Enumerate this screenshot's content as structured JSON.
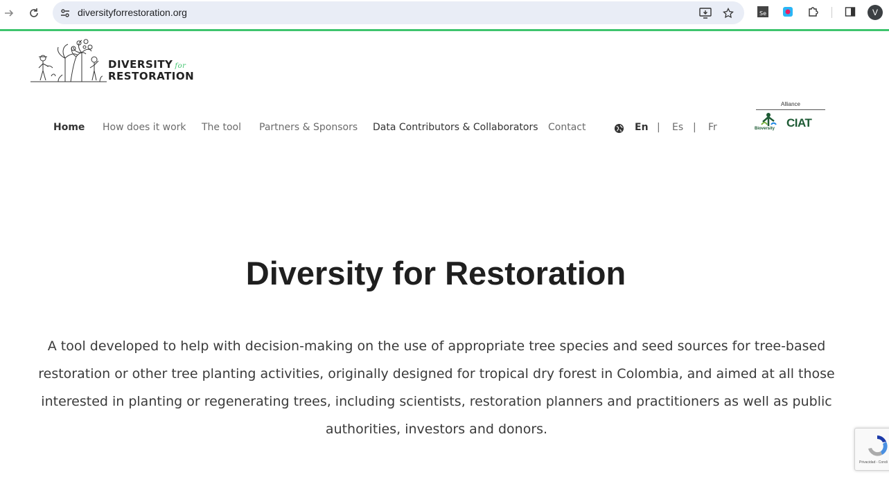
{
  "browser": {
    "url": "diversityforrestoration.org",
    "avatar_initial": "V"
  },
  "logo": {
    "line1": "DIVERSITY",
    "for": "for",
    "line2": "RESTORATION"
  },
  "nav": {
    "items": [
      {
        "label": "Home"
      },
      {
        "label": "How does it work"
      },
      {
        "label": "The tool"
      },
      {
        "label": "Partners & Sponsors"
      },
      {
        "label": "Data Contributors & Collaborators"
      },
      {
        "label": "Contact"
      }
    ]
  },
  "languages": {
    "en": "En",
    "es": "Es",
    "fr": "Fr",
    "separator": "|"
  },
  "partner": {
    "alliance": "Alliance",
    "bioversity": "Bioversity",
    "ciat": "CIAT"
  },
  "hero": {
    "title": "Diversity for Restoration",
    "description": "A tool developed to help with decision-making on the use of appropriate tree species and seed sources for tree-based restoration or other tree planting activities, originally designed for tropical dry forest in Colombia, and aimed at all those interested in planting or regenerating trees, including scientists, restoration planners and practitioners as well as public authorities, investors and donors."
  },
  "recaptcha": {
    "footer": "Privacidad - Condi"
  },
  "colors": {
    "accent_green": "#3ec46d",
    "ciat_green": "#1d5a34"
  }
}
